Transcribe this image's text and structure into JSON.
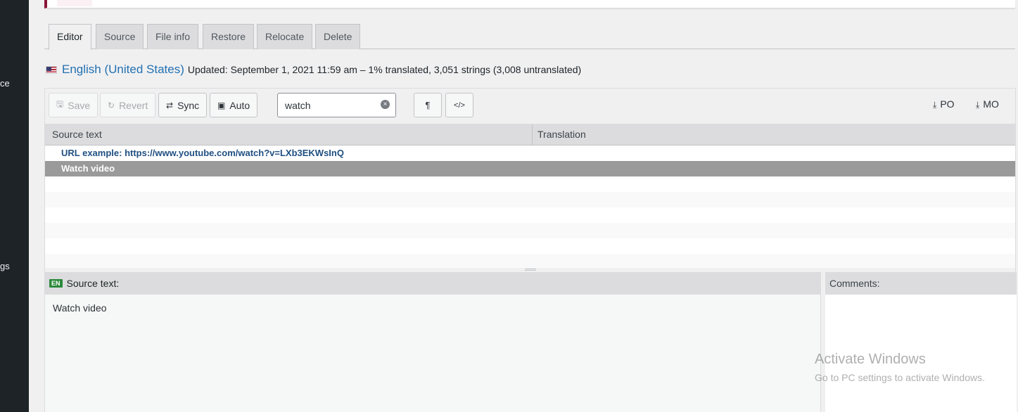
{
  "sidebar": {
    "fragments": [
      "ce",
      "gs"
    ]
  },
  "tabs": [
    {
      "label": "Editor",
      "active": true
    },
    {
      "label": "Source"
    },
    {
      "label": "File info"
    },
    {
      "label": "Restore"
    },
    {
      "label": "Relocate"
    },
    {
      "label": "Delete"
    }
  ],
  "locale": {
    "flag_icon": "us-flag-icon",
    "name": "English (United States)",
    "meta": "Updated: September 1, 2021 11:59 am – 1% translated, 3,051 strings (3,008 untranslated)"
  },
  "toolbar": {
    "save_label": "Save",
    "revert_label": "Revert",
    "sync_label": "Sync",
    "auto_label": "Auto",
    "search_value": "watch",
    "pilcrow_glyph": "¶",
    "code_glyph": "</>",
    "po_label": "PO",
    "mo_label": "MO"
  },
  "grid": {
    "source_header": "Source text",
    "translation_header": "Translation",
    "rows": [
      {
        "source": "URL example: https://www.youtube.com/watch?v=LXb3EKWsInQ"
      },
      {
        "source": "Watch video",
        "selected": true
      }
    ]
  },
  "source_pane": {
    "badge": "EN",
    "label": "Source text:",
    "text": "Watch video"
  },
  "comments_pane": {
    "label": "Comments:"
  },
  "watermark": {
    "title": "Activate Windows",
    "subtitle": "Go to PC settings to activate Windows."
  },
  "colors": {
    "accent": "#2271b1",
    "selected_row": "#9a9a9a",
    "sidebar": "#1d2327"
  }
}
